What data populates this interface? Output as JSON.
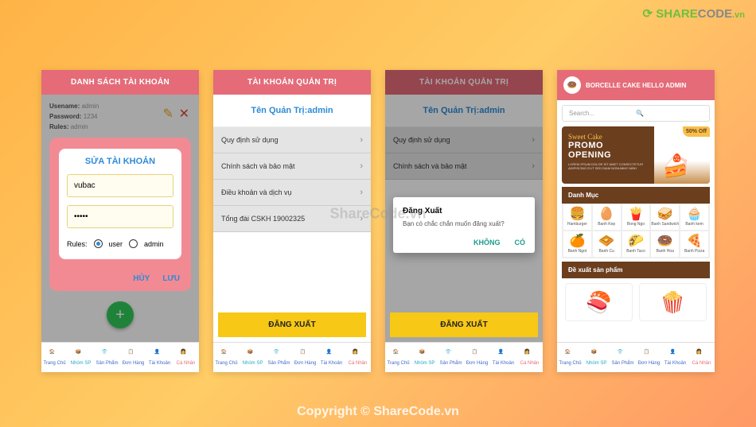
{
  "watermark": {
    "logo_a": "SHARE",
    "logo_b": "CODE",
    "logo_c": ".vn",
    "center": "ShareCode.vn",
    "bottom": "Copyright © ShareCode.vn"
  },
  "nav": {
    "items": [
      {
        "label": "Trang Chủ"
      },
      {
        "label": "Nhóm SP"
      },
      {
        "label": "Sản Phẩm"
      },
      {
        "label": "Đơn Hàng"
      },
      {
        "label": "Tài Khoản"
      },
      {
        "label": "Cá Nhân"
      }
    ]
  },
  "screen1": {
    "header": "DANH SÁCH TÀI KHOẢN",
    "info_user_label": "Usename:",
    "info_user": "admin",
    "info_pass_label": "Password:",
    "info_pass": "1234",
    "info_rules_label": "Rules:",
    "info_rules": "admin",
    "modal_title": "SỬA TÀI KHOẢN",
    "username_value": "vubac",
    "password_value": "•••••",
    "rules_label": "Rules:",
    "rules_user": "user",
    "rules_admin": "admin",
    "cancel": "HỦY",
    "save": "LƯU"
  },
  "screen2": {
    "header": "TÀI KHOẢN QUẢN TRỊ",
    "subtitle": "Tên Quản Trị:admin",
    "items": [
      "Quy định sử dụng",
      "Chính sách và bảo mật",
      "Điều khoản và dịch vụ",
      "Tổng đài CSKH 19002325"
    ],
    "logout": "ĐĂNG XUẤT"
  },
  "screen3": {
    "header": "TÀI KHOẢN QUẢN TRỊ",
    "subtitle": "Tên Quản Trị:admin",
    "items": [
      "Quy định sử dụng",
      "Chính sách và bảo mật"
    ],
    "dialog_title": "Đăng Xuất",
    "dialog_msg": "Bạn có chắc chắn muốn đăng xuất?",
    "no": "KHÔNG",
    "yes": "CÓ",
    "logout": "ĐĂNG XUẤT"
  },
  "screen4": {
    "title": "BORCELLE CAKE HELLO ADMIN",
    "search_placeholder": "Search...",
    "promo_script": "Sweet Cake",
    "promo_h1": "PROMO",
    "promo_h2": "OPENING",
    "promo_badge": "50% Off",
    "promo_small": "LOREM IPSUM DOLOR SIT AMET CONSECTETUR ADIPISCING ELIT SED DIAM NONUMMY NIBH",
    "cat_title": "Danh Mục",
    "cats": [
      {
        "icon": "🍔",
        "label": "Hamburger"
      },
      {
        "icon": "🥚",
        "label": "Banh Kep"
      },
      {
        "icon": "🍟",
        "label": "Bong Ngo"
      },
      {
        "icon": "🥪",
        "label": "Banh Sandwich"
      },
      {
        "icon": "🧁",
        "label": "Banh kem"
      },
      {
        "icon": "🍊",
        "label": "Banh Ngot"
      },
      {
        "icon": "🧇",
        "label": "Banh Cu"
      },
      {
        "icon": "🌮",
        "label": "Banh Taco"
      },
      {
        "icon": "🍩",
        "label": "Banh Hoa"
      },
      {
        "icon": "🍕",
        "label": "Banh Pizza"
      }
    ],
    "rec_title": "Đề xuất sản phẩm"
  }
}
